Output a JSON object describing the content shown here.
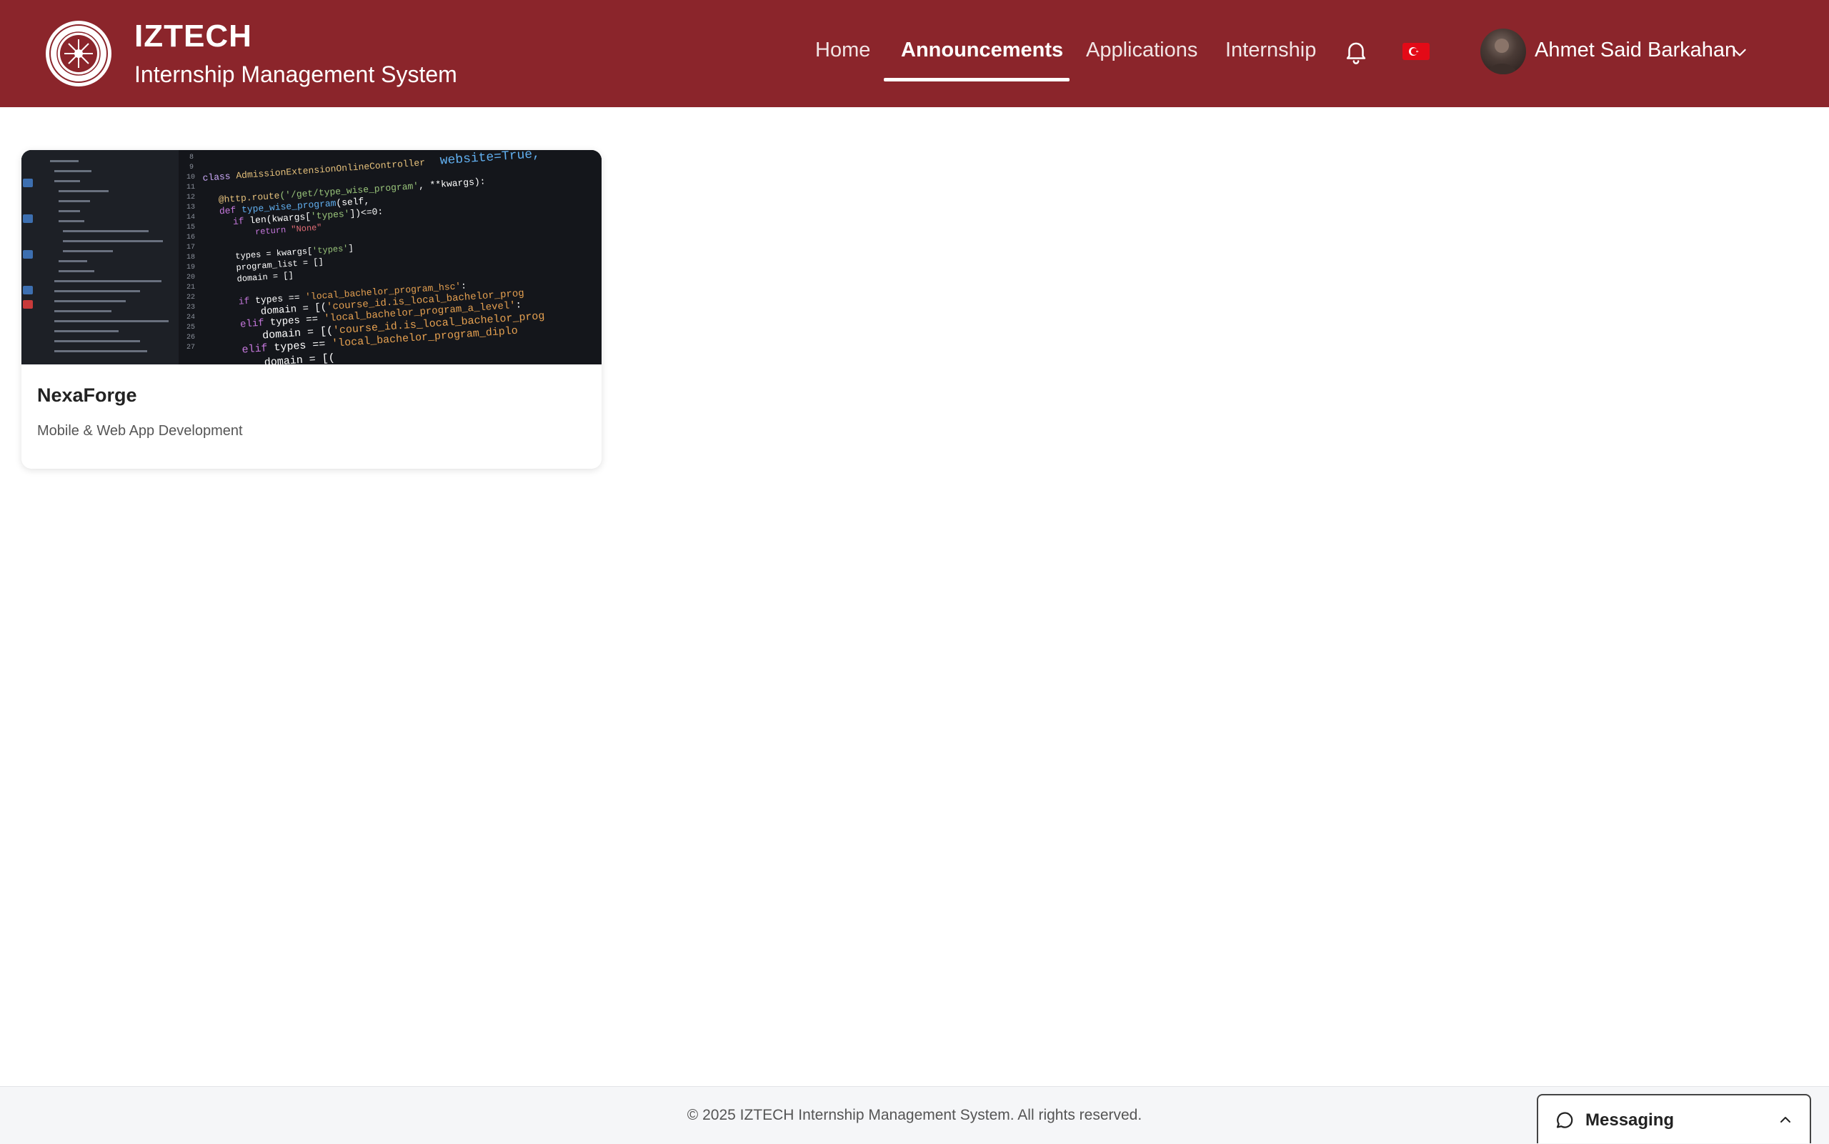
{
  "header": {
    "brand_title": "IZTECH",
    "brand_subtitle": "Internship Management System",
    "background_color": "#8b252b",
    "nav": [
      {
        "label": "Home",
        "active": false
      },
      {
        "label": "Announcements",
        "active": true
      },
      {
        "label": "Applications",
        "active": false
      },
      {
        "label": "Internship",
        "active": false
      }
    ],
    "notification_icon": "bell-icon",
    "language_flag": "turkey-flag-icon",
    "user": {
      "name": "Ahmet Said Barkahan",
      "menu_icon": "chevron-down-icon"
    }
  },
  "announcements": [
    {
      "title": "NexaForge",
      "subtitle": "Mobile & Web App Development",
      "image": "code-editor-screenshot"
    }
  ],
  "footer": {
    "copyright": "© 2025 IZTECH Internship Management System. All rights reserved."
  },
  "messaging": {
    "label": "Messaging",
    "icon": "chat-bubble-icon",
    "toggle_icon": "chevron-up-icon"
  }
}
